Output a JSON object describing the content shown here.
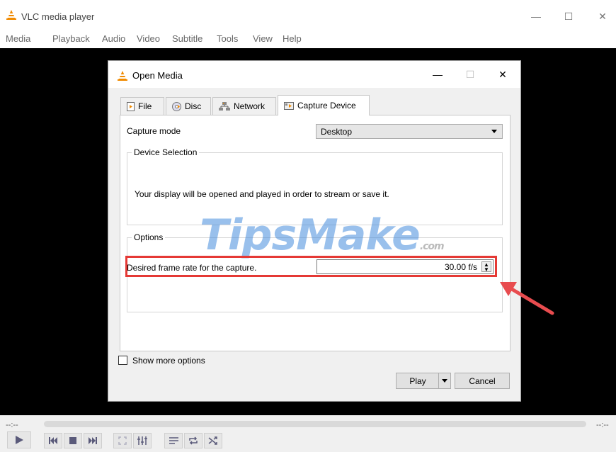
{
  "app": {
    "title": "VLC media player",
    "window_controls": {
      "minimize": "—",
      "maximize": "☐",
      "close": "✕"
    }
  },
  "menubar": {
    "items": [
      "Media",
      "Playback",
      "Audio",
      "Video",
      "Subtitle",
      "Tools",
      "View",
      "Help"
    ]
  },
  "player": {
    "elapsed_time": "--:--",
    "remaining_time": "--:--",
    "icons": [
      "play-icon",
      "previous-icon",
      "stop-icon",
      "next-icon",
      "fullscreen-icon",
      "extended-settings-icon",
      "playlist-icon",
      "loop-icon",
      "shuffle-icon"
    ]
  },
  "dialog": {
    "title": "Open Media",
    "controls": {
      "minimize": "—",
      "maximize": "☐",
      "close": "✕"
    },
    "tabs": [
      {
        "label": "File",
        "icon": "file-icon"
      },
      {
        "label": "Disc",
        "icon": "disc-icon"
      },
      {
        "label": "Network",
        "icon": "network-icon"
      },
      {
        "label": "Capture Device",
        "icon": "capture-device-icon",
        "active": true
      }
    ],
    "capture_mode": {
      "label": "Capture mode",
      "value": "Desktop"
    },
    "device_selection": {
      "legend": "Device Selection",
      "text": "Your display will be opened and played in order to stream or save it."
    },
    "options": {
      "legend": "Options",
      "frame_rate_label": "Desired frame rate for the capture.",
      "frame_rate_value": "30.00 f/s"
    },
    "show_more_options": {
      "label": "Show more options",
      "checked": false
    },
    "buttons": {
      "play": "Play",
      "cancel": "Cancel"
    }
  },
  "watermark": {
    "main": "TipsMake",
    "suffix": ".com"
  },
  "colors": {
    "highlight": "#e53935",
    "arrow": "#e84c4f",
    "vlc_orange": "#f08a00"
  }
}
